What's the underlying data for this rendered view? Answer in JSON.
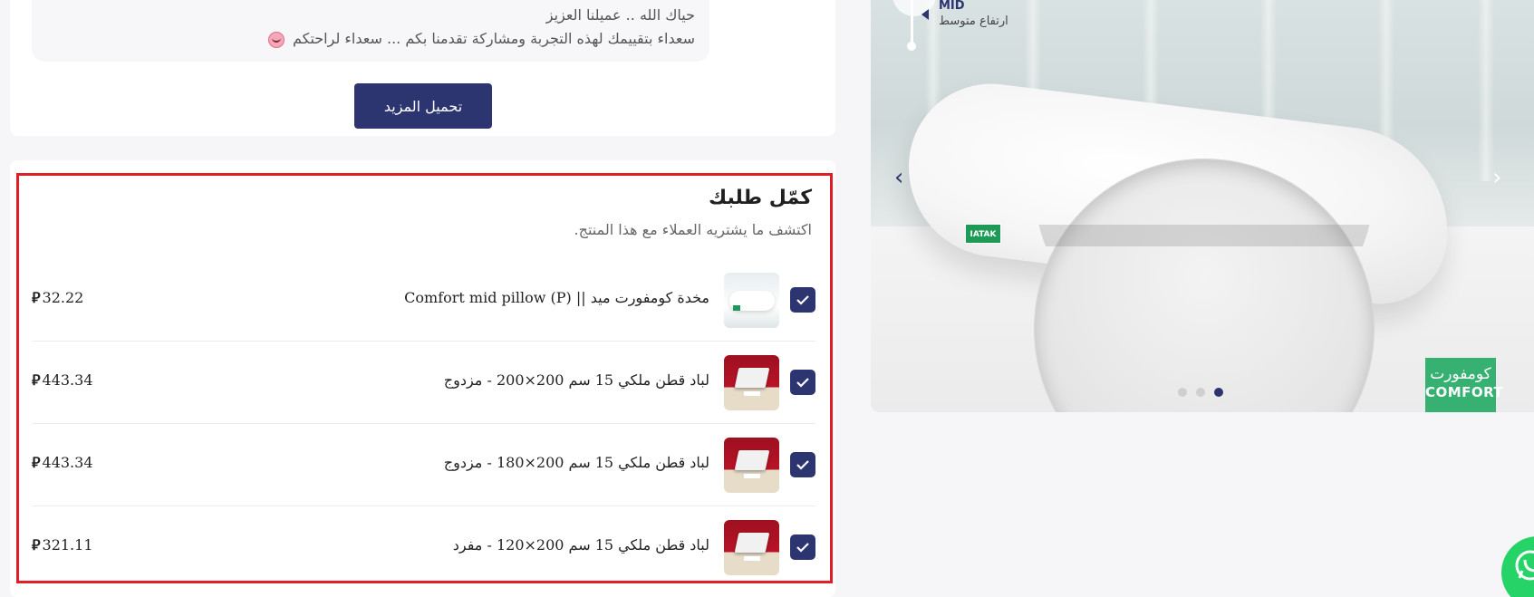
{
  "review": {
    "line1": "حياك الله .. عميلنا العزيز",
    "line2": "سعداء بتقييمك لهذه التجربة ومشاركة تقدمنا بكم ... سعداء لراحتكم"
  },
  "load_more_label": "تحميل المزيد",
  "complete_order": {
    "title": "كمّل طلبك",
    "subtitle": "اكتشف ما يشتريه العملاء مع هذا المنتج.",
    "currency_symbol": "⃁",
    "items": [
      {
        "title": "مخدة كومفورت ميد || Comfort mid pillow (P)",
        "price": "32.22",
        "checked": true,
        "thumb": "pillow"
      },
      {
        "title": "لباد قطن ملكي 15 سم 200×200 - مزدوج",
        "price": "443.34",
        "checked": true,
        "thumb": "mattress"
      },
      {
        "title": "لباد قطن ملكي 15 سم 200×180 - مزدوج",
        "price": "443.34",
        "checked": true,
        "thumb": "mattress"
      },
      {
        "title": "لباد قطن ملكي 15 سم 200×120 - مفرد",
        "price": "321.11",
        "checked": true,
        "thumb": "mattress"
      }
    ]
  },
  "hero": {
    "height_label": "MID",
    "height_sub": "ارتفاع متوسط",
    "pillow_tag": "IATAK",
    "logo_ar": "كومفورت",
    "logo_en": "COMFORT",
    "active_slide": 3,
    "slide_count": 3
  },
  "colors": {
    "primary": "#2c3570",
    "highlight_border": "#e11d26",
    "brand_green": "#36b172",
    "whatsapp": "#25d366"
  }
}
